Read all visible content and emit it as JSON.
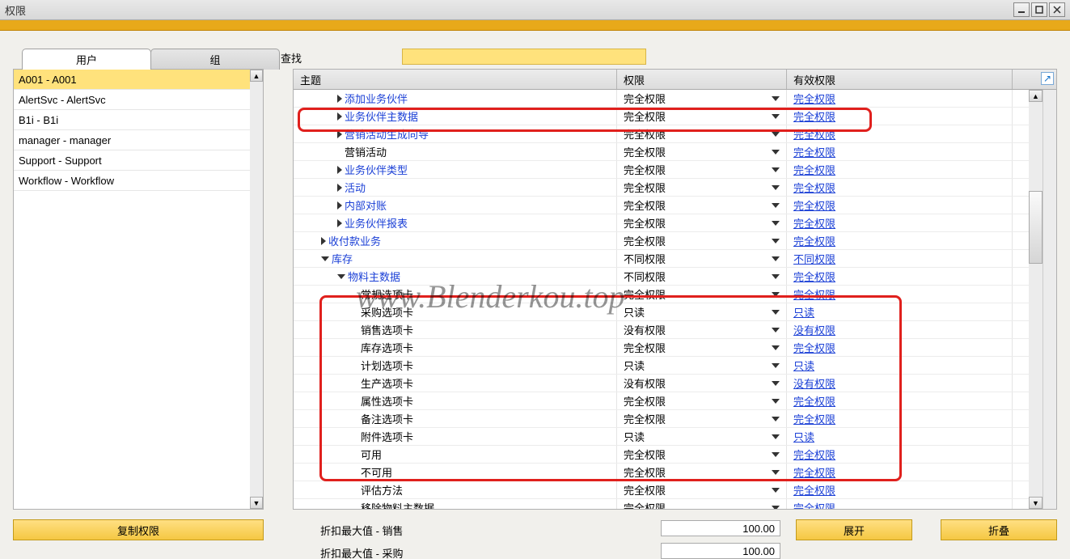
{
  "window": {
    "title": "权限"
  },
  "tabs": {
    "user": "用户",
    "group": "组"
  },
  "users": [
    "A001 - A001",
    "AlertSvc - AlertSvc",
    "B1i - B1i",
    "manager - manager",
    "Support - Support",
    "Workflow - Workflow"
  ],
  "buttons": {
    "copy": "复制权限",
    "expand": "展开",
    "collapse": "折叠"
  },
  "search_label": "查找",
  "columns": {
    "subject": "主题",
    "perm": "权限",
    "eff": "有效权限"
  },
  "rows": [
    {
      "indent": 2,
      "arrow": "r",
      "label": "添加业务伙伴",
      "blue": true,
      "perm": "完全权限",
      "eff": "完全权限"
    },
    {
      "indent": 2,
      "arrow": "r",
      "label": "业务伙伴主数据",
      "blue": true,
      "perm": "完全权限",
      "eff": "完全权限"
    },
    {
      "indent": 2,
      "arrow": "r",
      "label": "营销活动生成向导",
      "blue": true,
      "perm": "完全权限",
      "eff": "完全权限"
    },
    {
      "indent": 2,
      "arrow": "",
      "label": "营销活动",
      "blue": false,
      "perm": "完全权限",
      "eff": "完全权限"
    },
    {
      "indent": 2,
      "arrow": "r",
      "label": "业务伙伴类型",
      "blue": true,
      "perm": "完全权限",
      "eff": "完全权限"
    },
    {
      "indent": 2,
      "arrow": "r",
      "label": "活动",
      "blue": true,
      "perm": "完全权限",
      "eff": "完全权限"
    },
    {
      "indent": 2,
      "arrow": "r",
      "label": "内部对账",
      "blue": true,
      "perm": "完全权限",
      "eff": "完全权限"
    },
    {
      "indent": 2,
      "arrow": "r",
      "label": "业务伙伴报表",
      "blue": true,
      "perm": "完全权限",
      "eff": "完全权限"
    },
    {
      "indent": 1,
      "arrow": "r",
      "label": "收付款业务",
      "blue": true,
      "perm": "完全权限",
      "eff": "完全权限"
    },
    {
      "indent": 1,
      "arrow": "d",
      "label": "库存",
      "blue": true,
      "perm": "不同权限",
      "eff": "不同权限"
    },
    {
      "indent": 2,
      "arrow": "d",
      "label": "物料主数据",
      "blue": true,
      "perm": "不同权限",
      "eff": "完全权限"
    },
    {
      "indent": 3,
      "arrow": "",
      "label": "常规选项卡",
      "blue": false,
      "perm": "完全权限",
      "eff": "完全权限"
    },
    {
      "indent": 3,
      "arrow": "",
      "label": "采购选项卡",
      "blue": false,
      "perm": "只读",
      "eff": "只读"
    },
    {
      "indent": 3,
      "arrow": "",
      "label": "销售选项卡",
      "blue": false,
      "perm": "没有权限",
      "eff": "没有权限"
    },
    {
      "indent": 3,
      "arrow": "",
      "label": "库存选项卡",
      "blue": false,
      "perm": "完全权限",
      "eff": "完全权限"
    },
    {
      "indent": 3,
      "arrow": "",
      "label": "计划选项卡",
      "blue": false,
      "perm": "只读",
      "eff": "只读"
    },
    {
      "indent": 3,
      "arrow": "",
      "label": "生产选项卡",
      "blue": false,
      "perm": "没有权限",
      "eff": "没有权限"
    },
    {
      "indent": 3,
      "arrow": "",
      "label": "属性选项卡",
      "blue": false,
      "perm": "完全权限",
      "eff": "完全权限"
    },
    {
      "indent": 3,
      "arrow": "",
      "label": "备注选项卡",
      "blue": false,
      "perm": "完全权限",
      "eff": "完全权限"
    },
    {
      "indent": 3,
      "arrow": "",
      "label": "附件选项卡",
      "blue": false,
      "perm": "只读",
      "eff": "只读"
    },
    {
      "indent": 3,
      "arrow": "",
      "label": "可用",
      "blue": false,
      "perm": "完全权限",
      "eff": "完全权限"
    },
    {
      "indent": 3,
      "arrow": "",
      "label": "不可用",
      "blue": false,
      "perm": "完全权限",
      "eff": "完全权限"
    },
    {
      "indent": 3,
      "arrow": "",
      "label": "评估方法",
      "blue": false,
      "perm": "完全权限",
      "eff": "完全权限"
    },
    {
      "indent": 3,
      "arrow": "",
      "label": "移除物料主数据",
      "blue": false,
      "perm": "完全权限",
      "eff": "完全权限"
    }
  ],
  "discount": {
    "sales_label": "折扣最大值 - 销售",
    "sales_value": "100.00",
    "purchase_label": "折扣最大值 - 采购",
    "purchase_value": "100.00"
  },
  "watermark": "www.Blenderkou.top"
}
